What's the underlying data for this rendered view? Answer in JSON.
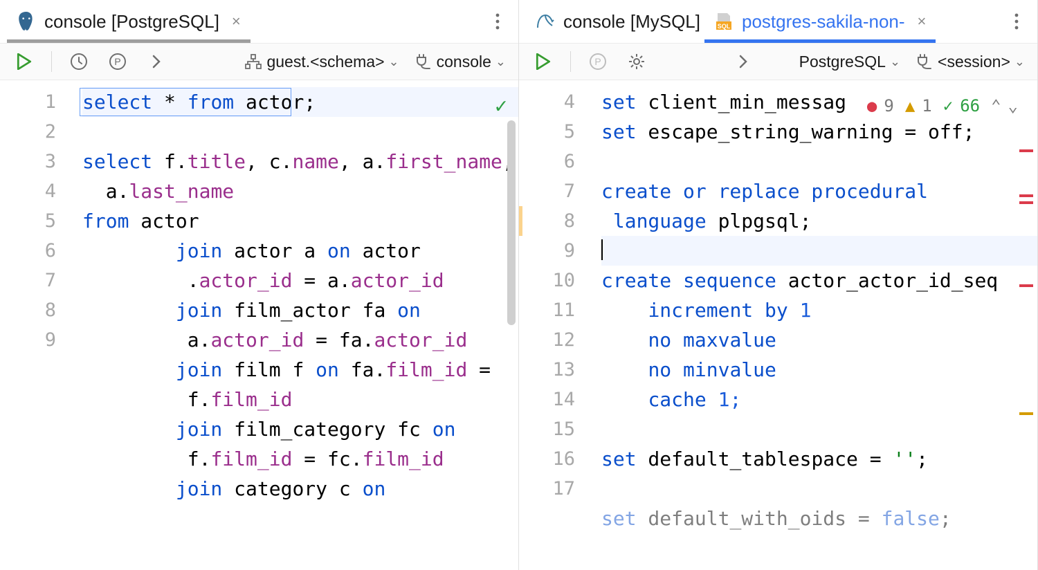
{
  "left": {
    "tab": {
      "title": "console [PostgreSQL]"
    },
    "toolbar": {
      "schema": "guest.<schema>",
      "session": "console"
    },
    "lines": [
      "1",
      "2",
      "3",
      " ",
      "4",
      "5",
      " ",
      "6",
      " ",
      "7",
      " ",
      "8",
      " ",
      "9"
    ],
    "code": {
      "l1": {
        "a": "select",
        "b": " * ",
        "c": "from",
        "d": " actor;"
      },
      "l3_1": {
        "a": "select",
        "b": " f.",
        "c": "title",
        "d": ", c.",
        "e": "name",
        "f": ", a.",
        "g": "first_name",
        "h": ","
      },
      "l3_2": {
        "pad": "  a.",
        "a": "last_name"
      },
      "l4": {
        "a": "from",
        "b": " actor"
      },
      "l5_1": {
        "pad": "        ",
        "a": "join",
        "b": " actor a ",
        "c": "on",
        "d": " actor"
      },
      "l5_2": {
        "pad": "         .",
        "a": "actor_id",
        "b": " = a.",
        "c": "actor_id"
      },
      "l6_1": {
        "pad": "        ",
        "a": "join",
        "b": " film_actor fa ",
        "c": "on"
      },
      "l6_2": {
        "pad": "         a.",
        "a": "actor_id",
        "b": " = fa.",
        "c": "actor_id"
      },
      "l7_1": {
        "pad": "        ",
        "a": "join",
        "b": " film f ",
        "c": "on",
        "d": " fa.",
        "e": "film_id",
        "f": " ="
      },
      "l7_2": {
        "pad": "         f.",
        "a": "film_id"
      },
      "l8_1": {
        "pad": "        ",
        "a": "join",
        "b": " film_category fc ",
        "c": "on"
      },
      "l8_2": {
        "pad": "         f.",
        "a": "film_id",
        "b": " = fc.",
        "c": "film_id"
      },
      "l9_1": {
        "pad": "        ",
        "a": "join",
        "b": " category c ",
        "c": "on"
      }
    }
  },
  "right": {
    "tabs": [
      {
        "title": "console [MySQL]",
        "active": false
      },
      {
        "title": "postgres-sakila-non-",
        "active": true
      }
    ],
    "toolbar": {
      "dialect": "PostgreSQL",
      "session": "<session>"
    },
    "status": {
      "errors": "9",
      "warnings": "1",
      "ok": "66"
    },
    "lines": [
      "4",
      "5",
      "6",
      "7",
      " ",
      "8",
      "9",
      "10",
      "11",
      "12",
      "13",
      "14",
      "15",
      "16",
      "17"
    ],
    "code": {
      "l4": {
        "a": "set",
        "b": " client_min_messag"
      },
      "l5": {
        "a": "set",
        "b": " escape_string_warning = off;"
      },
      "l7_1": {
        "a": "create or replace procedural"
      },
      "l7_2": {
        "pad": " ",
        "a": "language",
        "b": " plpgsql;"
      },
      "l9": {
        "a": "create sequence",
        "b": " actor_actor_id_seq"
      },
      "l10": {
        "pad": "    ",
        "a": "increment by",
        "b": " 1"
      },
      "l11": {
        "pad": "    ",
        "a": "no maxvalue"
      },
      "l12": {
        "pad": "    ",
        "a": "no minvalue"
      },
      "l13": {
        "pad": "    ",
        "a": "cache",
        "b": " 1;"
      },
      "l15": {
        "a": "set",
        "b": " default_tablespace = ",
        "c": "''",
        "d": ";"
      },
      "l17": {
        "a": "set",
        "b": " default_with_oids = ",
        "c": "false",
        "d": ";"
      }
    }
  }
}
